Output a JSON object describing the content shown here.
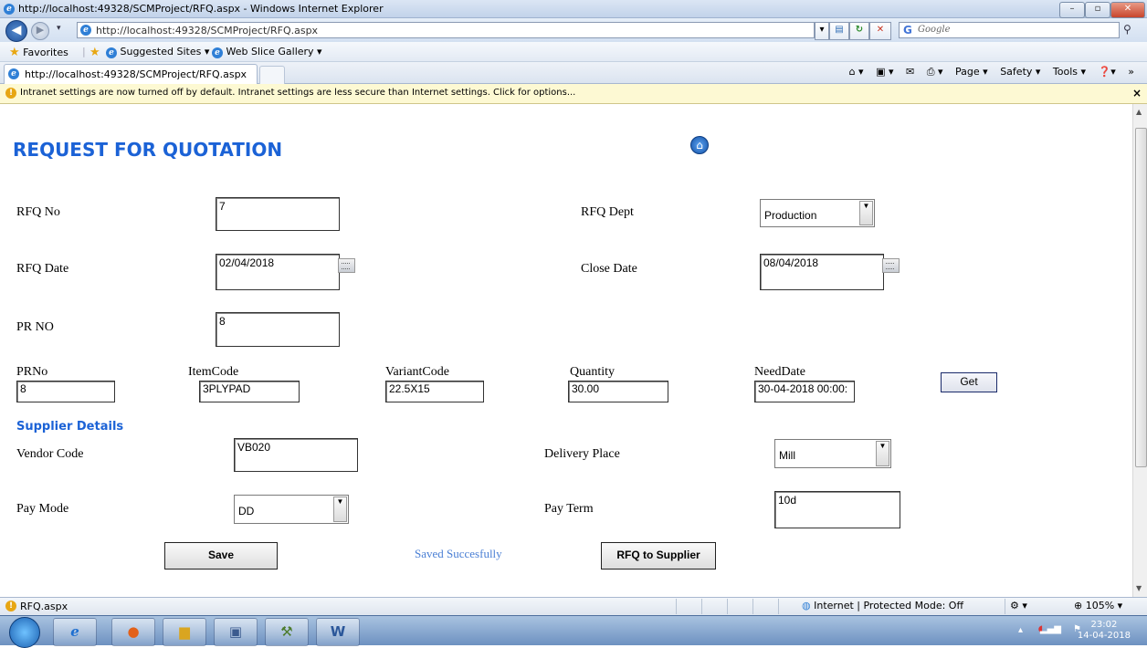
{
  "window": {
    "title": "http://localhost:49328/SCMProject/RFQ.aspx - Windows Internet Explorer",
    "controls": [
      "–",
      "▫",
      "✕"
    ]
  },
  "addressbar": {
    "url": "http://localhost:49328/SCMProject/RFQ.aspx",
    "search_placeholder": "Google",
    "search_logo": "G"
  },
  "favorites": {
    "label": "Favorites",
    "items": [
      "Suggested Sites ▾",
      "Web Slice Gallery ▾"
    ]
  },
  "tab": {
    "title": "http://localhost:49328/SCMProject/RFQ.aspx"
  },
  "command_bar": {
    "items": [
      "Page ▾",
      "Safety ▾",
      "Tools ▾"
    ]
  },
  "info_bar": {
    "message": "Intranet settings are now turned off by default. Intranet settings are less secure than Internet settings. Click for options...",
    "close": "×"
  },
  "page": {
    "title": "REQUEST FOR QUOTATION",
    "fields": {
      "rfq_no_label": "RFQ No",
      "rfq_no_value": "7",
      "rfq_dept_label": "RFQ Dept",
      "rfq_dept_value": "Production",
      "rfq_date_label": "RFQ Date",
      "rfq_date_value": "02/04/2018",
      "close_date_label": "Close Date",
      "close_date_value": "08/04/2018",
      "pr_no_label": "PR NO",
      "pr_no_value": "8"
    },
    "items_grid": {
      "columns": [
        "PRNo",
        "ItemCode",
        "VariantCode",
        "Quantity",
        "NeedDate"
      ],
      "values": [
        "8",
        "3PLYPAD",
        "22.5X15",
        "30.00",
        "30-04-2018 00:00:"
      ],
      "get_label": "Get"
    },
    "supplier": {
      "heading": "Supplier Details",
      "vendor_code_label": "Vendor Code",
      "vendor_code_value": "VB020",
      "delivery_place_label": "Delivery Place",
      "delivery_place_value": "Mill",
      "pay_mode_label": "Pay Mode",
      "pay_mode_value": "DD",
      "pay_term_label": "Pay Term",
      "pay_term_value": "10d"
    },
    "actions": {
      "save_label": "Save",
      "status_message": "Saved Succesfully",
      "rfq_supplier_label": "RFQ to Supplier"
    }
  },
  "statusbar": {
    "page": "RFQ.aspx",
    "zone": "Internet | Protected Mode: Off",
    "zoom": "105%"
  },
  "taskbar": {
    "time": "23:02",
    "date": "14-04-2018"
  },
  "colors": {
    "heading": "#1b62d6",
    "status_message": "#4a7fd4",
    "info_bar": "#fdf9d3"
  }
}
